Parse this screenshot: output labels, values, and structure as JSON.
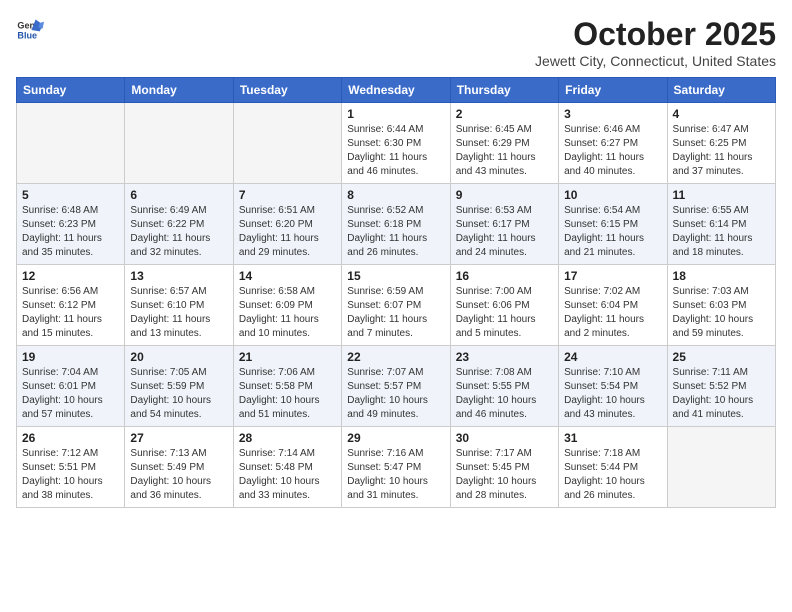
{
  "logo": {
    "line1": "General",
    "line2": "Blue"
  },
  "title": "October 2025",
  "subtitle": "Jewett City, Connecticut, United States",
  "weekdays": [
    "Sunday",
    "Monday",
    "Tuesday",
    "Wednesday",
    "Thursday",
    "Friday",
    "Saturday"
  ],
  "weeks": [
    [
      {
        "day": "",
        "info": ""
      },
      {
        "day": "",
        "info": ""
      },
      {
        "day": "",
        "info": ""
      },
      {
        "day": "1",
        "info": "Sunrise: 6:44 AM\nSunset: 6:30 PM\nDaylight: 11 hours\nand 46 minutes."
      },
      {
        "day": "2",
        "info": "Sunrise: 6:45 AM\nSunset: 6:29 PM\nDaylight: 11 hours\nand 43 minutes."
      },
      {
        "day": "3",
        "info": "Sunrise: 6:46 AM\nSunset: 6:27 PM\nDaylight: 11 hours\nand 40 minutes."
      },
      {
        "day": "4",
        "info": "Sunrise: 6:47 AM\nSunset: 6:25 PM\nDaylight: 11 hours\nand 37 minutes."
      }
    ],
    [
      {
        "day": "5",
        "info": "Sunrise: 6:48 AM\nSunset: 6:23 PM\nDaylight: 11 hours\nand 35 minutes."
      },
      {
        "day": "6",
        "info": "Sunrise: 6:49 AM\nSunset: 6:22 PM\nDaylight: 11 hours\nand 32 minutes."
      },
      {
        "day": "7",
        "info": "Sunrise: 6:51 AM\nSunset: 6:20 PM\nDaylight: 11 hours\nand 29 minutes."
      },
      {
        "day": "8",
        "info": "Sunrise: 6:52 AM\nSunset: 6:18 PM\nDaylight: 11 hours\nand 26 minutes."
      },
      {
        "day": "9",
        "info": "Sunrise: 6:53 AM\nSunset: 6:17 PM\nDaylight: 11 hours\nand 24 minutes."
      },
      {
        "day": "10",
        "info": "Sunrise: 6:54 AM\nSunset: 6:15 PM\nDaylight: 11 hours\nand 21 minutes."
      },
      {
        "day": "11",
        "info": "Sunrise: 6:55 AM\nSunset: 6:14 PM\nDaylight: 11 hours\nand 18 minutes."
      }
    ],
    [
      {
        "day": "12",
        "info": "Sunrise: 6:56 AM\nSunset: 6:12 PM\nDaylight: 11 hours\nand 15 minutes."
      },
      {
        "day": "13",
        "info": "Sunrise: 6:57 AM\nSunset: 6:10 PM\nDaylight: 11 hours\nand 13 minutes."
      },
      {
        "day": "14",
        "info": "Sunrise: 6:58 AM\nSunset: 6:09 PM\nDaylight: 11 hours\nand 10 minutes."
      },
      {
        "day": "15",
        "info": "Sunrise: 6:59 AM\nSunset: 6:07 PM\nDaylight: 11 hours\nand 7 minutes."
      },
      {
        "day": "16",
        "info": "Sunrise: 7:00 AM\nSunset: 6:06 PM\nDaylight: 11 hours\nand 5 minutes."
      },
      {
        "day": "17",
        "info": "Sunrise: 7:02 AM\nSunset: 6:04 PM\nDaylight: 11 hours\nand 2 minutes."
      },
      {
        "day": "18",
        "info": "Sunrise: 7:03 AM\nSunset: 6:03 PM\nDaylight: 10 hours\nand 59 minutes."
      }
    ],
    [
      {
        "day": "19",
        "info": "Sunrise: 7:04 AM\nSunset: 6:01 PM\nDaylight: 10 hours\nand 57 minutes."
      },
      {
        "day": "20",
        "info": "Sunrise: 7:05 AM\nSunset: 5:59 PM\nDaylight: 10 hours\nand 54 minutes."
      },
      {
        "day": "21",
        "info": "Sunrise: 7:06 AM\nSunset: 5:58 PM\nDaylight: 10 hours\nand 51 minutes."
      },
      {
        "day": "22",
        "info": "Sunrise: 7:07 AM\nSunset: 5:57 PM\nDaylight: 10 hours\nand 49 minutes."
      },
      {
        "day": "23",
        "info": "Sunrise: 7:08 AM\nSunset: 5:55 PM\nDaylight: 10 hours\nand 46 minutes."
      },
      {
        "day": "24",
        "info": "Sunrise: 7:10 AM\nSunset: 5:54 PM\nDaylight: 10 hours\nand 43 minutes."
      },
      {
        "day": "25",
        "info": "Sunrise: 7:11 AM\nSunset: 5:52 PM\nDaylight: 10 hours\nand 41 minutes."
      }
    ],
    [
      {
        "day": "26",
        "info": "Sunrise: 7:12 AM\nSunset: 5:51 PM\nDaylight: 10 hours\nand 38 minutes."
      },
      {
        "day": "27",
        "info": "Sunrise: 7:13 AM\nSunset: 5:49 PM\nDaylight: 10 hours\nand 36 minutes."
      },
      {
        "day": "28",
        "info": "Sunrise: 7:14 AM\nSunset: 5:48 PM\nDaylight: 10 hours\nand 33 minutes."
      },
      {
        "day": "29",
        "info": "Sunrise: 7:16 AM\nSunset: 5:47 PM\nDaylight: 10 hours\nand 31 minutes."
      },
      {
        "day": "30",
        "info": "Sunrise: 7:17 AM\nSunset: 5:45 PM\nDaylight: 10 hours\nand 28 minutes."
      },
      {
        "day": "31",
        "info": "Sunrise: 7:18 AM\nSunset: 5:44 PM\nDaylight: 10 hours\nand 26 minutes."
      },
      {
        "day": "",
        "info": ""
      }
    ]
  ]
}
